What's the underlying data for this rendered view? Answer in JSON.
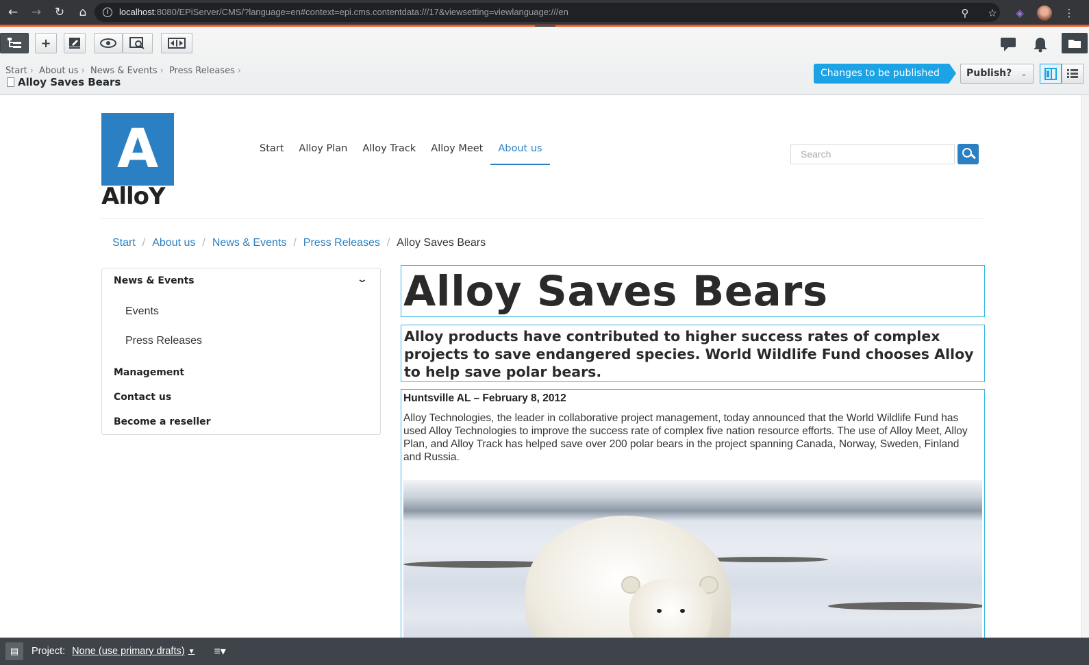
{
  "browser": {
    "url_host": "localhost",
    "url_rest": ":8080/EPiServer/CMS/?language=en#context=epi.cms.contentdata:///17&viewsetting=viewlanguage:///en"
  },
  "cms": {
    "breadcrumb": [
      "Start",
      "About us",
      "News & Events",
      "Press Releases"
    ],
    "page_title": "Alloy Saves Bears",
    "status": "Changes to be published",
    "publish_label": "Publish?"
  },
  "site": {
    "logo_letter": "A",
    "logo_text": "AlloY",
    "nav": [
      "Start",
      "Alloy Plan",
      "Alloy Track",
      "Alloy Meet",
      "About us"
    ],
    "search_placeholder": "Search",
    "breadcrumb": [
      "Start",
      "About us",
      "News & Events",
      "Press Releases"
    ],
    "breadcrumb_current": "Alloy Saves Bears",
    "subnav": {
      "heading": "News & Events",
      "children": [
        "Events",
        "Press Releases"
      ],
      "siblings": [
        "Management",
        "Contact us",
        "Become a reseller"
      ]
    }
  },
  "article": {
    "heading": "Alloy Saves Bears",
    "intro": "Alloy products have contributed to higher success rates of complex projects to save endangered species. World Wildlife Fund chooses Alloy to help save polar bears.",
    "dateline": "Huntsville AL – February 8, 2012",
    "body": "Alloy Technologies, the leader in collaborative project management, today announced that the World Wildlife Fund has used Alloy Technologies to improve the success rate of complex five nation resource efforts. The use of Alloy Meet, Alloy Plan, and Alloy Track has helped save over 200 polar bears in the project spanning Canada, Norway, Sweden, Finland and Russia."
  },
  "project_bar": {
    "label": "Project:",
    "value": "None (use primary drafts)"
  },
  "colors": {
    "accent": "#2a80c2",
    "status_blue": "#1ca3e6",
    "edit_outline": "#2fb5e3",
    "browser_bar": "#35363a",
    "orange_strip": "#f05a24"
  }
}
